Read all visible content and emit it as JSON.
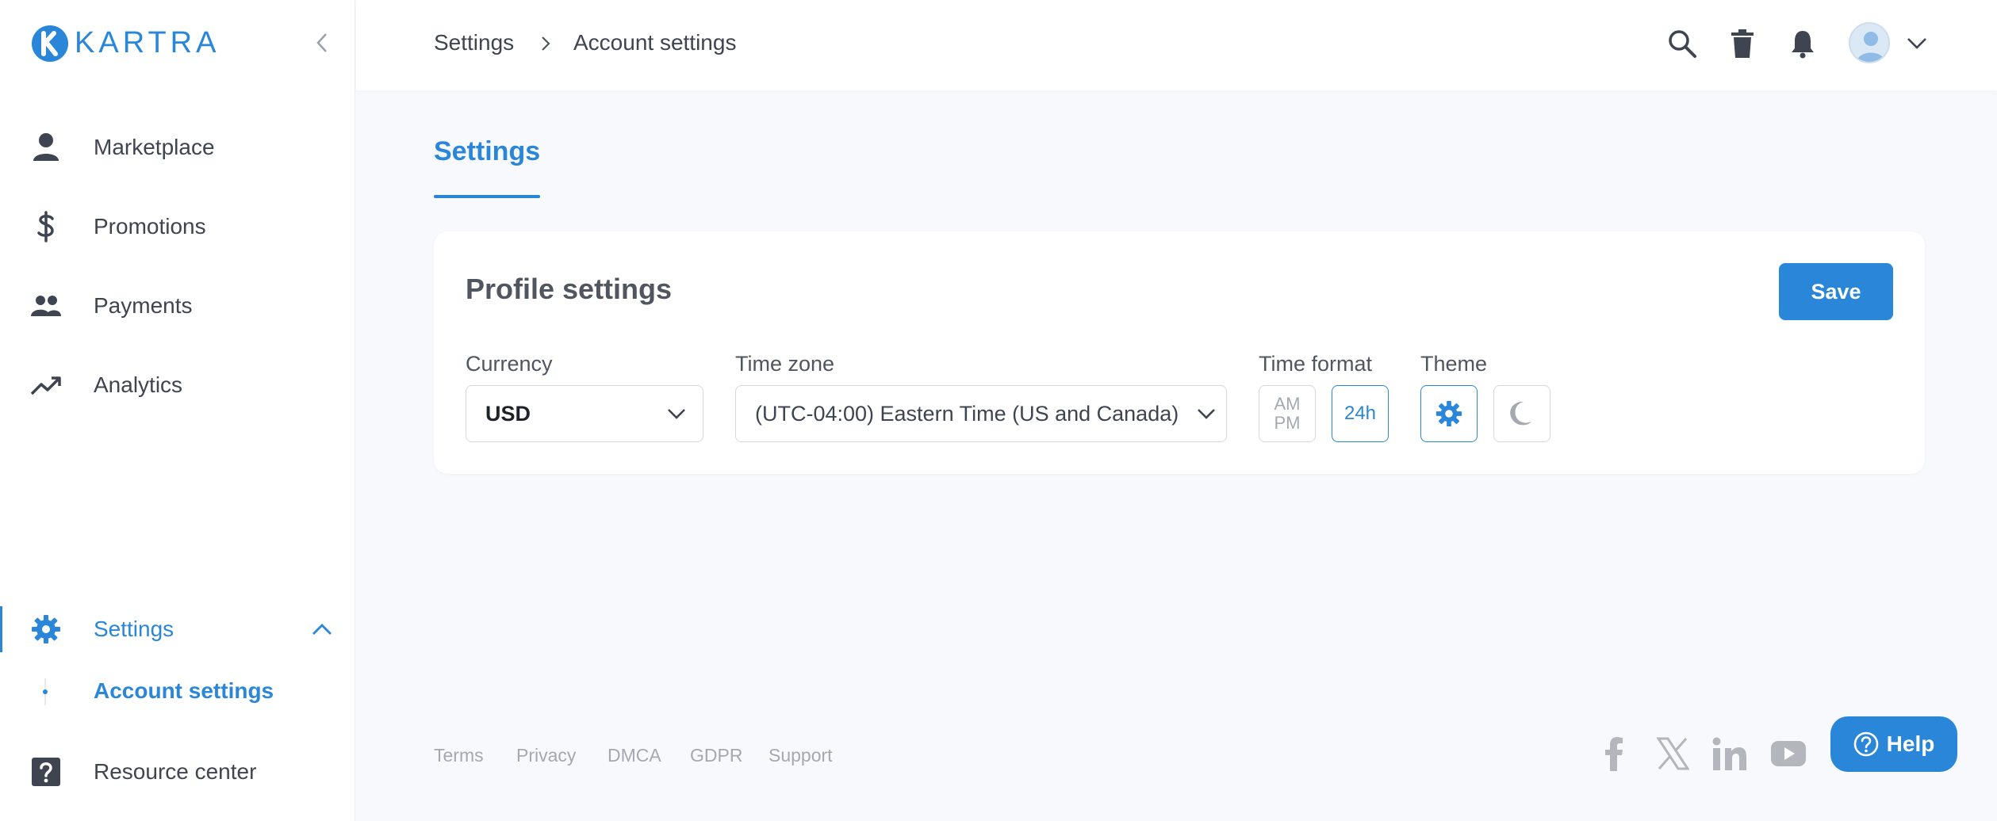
{
  "brand": {
    "name": "KARTRA",
    "color": "#2a86d8"
  },
  "sidebar": {
    "items": [
      {
        "label": "Marketplace",
        "icon": "person-icon"
      },
      {
        "label": "Promotions",
        "icon": "dollar-icon"
      },
      {
        "label": "Payments",
        "icon": "people-icon"
      },
      {
        "label": "Analytics",
        "icon": "trending-up-icon"
      },
      {
        "label": "Settings",
        "icon": "gear-icon",
        "active": true
      },
      {
        "label": "Resource center",
        "icon": "help-square-icon"
      }
    ],
    "sub_items": [
      {
        "label": "Account settings",
        "active": true
      }
    ]
  },
  "header": {
    "breadcrumb": [
      "Settings",
      "Account settings"
    ],
    "icons": [
      "search-icon",
      "trash-icon",
      "bell-icon",
      "avatar",
      "chevron-down-icon"
    ]
  },
  "page": {
    "tab": "Settings",
    "card": {
      "title": "Profile settings",
      "save_label": "Save",
      "currency": {
        "label": "Currency",
        "value": "USD"
      },
      "timezone": {
        "label": "Time zone",
        "value": "(UTC-04:00) Eastern Time (US and Canada)"
      },
      "time_format": {
        "label": "Time format",
        "options": [
          "AM",
          "PM",
          "24h"
        ],
        "selected": "24h"
      },
      "theme": {
        "label": "Theme",
        "options": [
          "light",
          "dark"
        ],
        "selected": "light"
      }
    }
  },
  "footer": {
    "links": [
      "Terms",
      "Privacy",
      "DMCA",
      "GDPR",
      "Support"
    ],
    "social": [
      "facebook-icon",
      "x-icon",
      "linkedin-icon",
      "youtube-icon"
    ]
  },
  "help": {
    "label": "Help"
  }
}
